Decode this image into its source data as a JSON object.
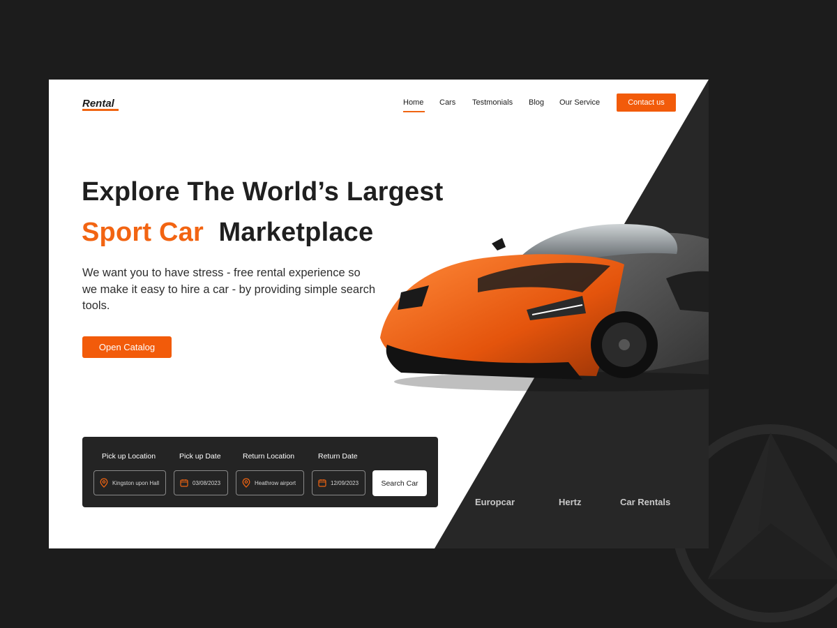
{
  "site": {
    "logo": "Rental"
  },
  "nav": {
    "items": [
      {
        "label": "Home",
        "active": true
      },
      {
        "label": "Cars",
        "active": false
      },
      {
        "label": "Testmonials",
        "active": false
      },
      {
        "label": "Blog",
        "active": false
      },
      {
        "label": "Our Service",
        "active": false
      }
    ],
    "contact_label": "Contact us"
  },
  "hero": {
    "line1": "Explore The World’s Largest",
    "line2_accent": "Sport Car",
    "line2_rest": "Marketplace",
    "subtitle": "We want you to have stress - free rental experience so we make it easy to hire a car - by providing simple search tools.",
    "cta_label": "Open Catalog"
  },
  "search": {
    "pickup_location": {
      "label": "Pick up Location",
      "value": "Kingston upon Hall",
      "icon": "location-pin-icon"
    },
    "pickup_date": {
      "label": "Pick up Date",
      "value": "03/08/2023",
      "icon": "calendar-icon"
    },
    "return_location": {
      "label": "Return Location",
      "value": "Heathrow airport",
      "icon": "location-pin-icon"
    },
    "return_date": {
      "label": "Return Date",
      "value": "12/09/2023",
      "icon": "calendar-icon"
    },
    "button_label": "Search Car"
  },
  "partners": [
    "Europcar",
    "Hertz",
    "Car Rentals"
  ],
  "colors": {
    "accent": "#f25b0a",
    "dark": "#242424",
    "background": "#1c1c1c",
    "card": "#ffffff"
  }
}
